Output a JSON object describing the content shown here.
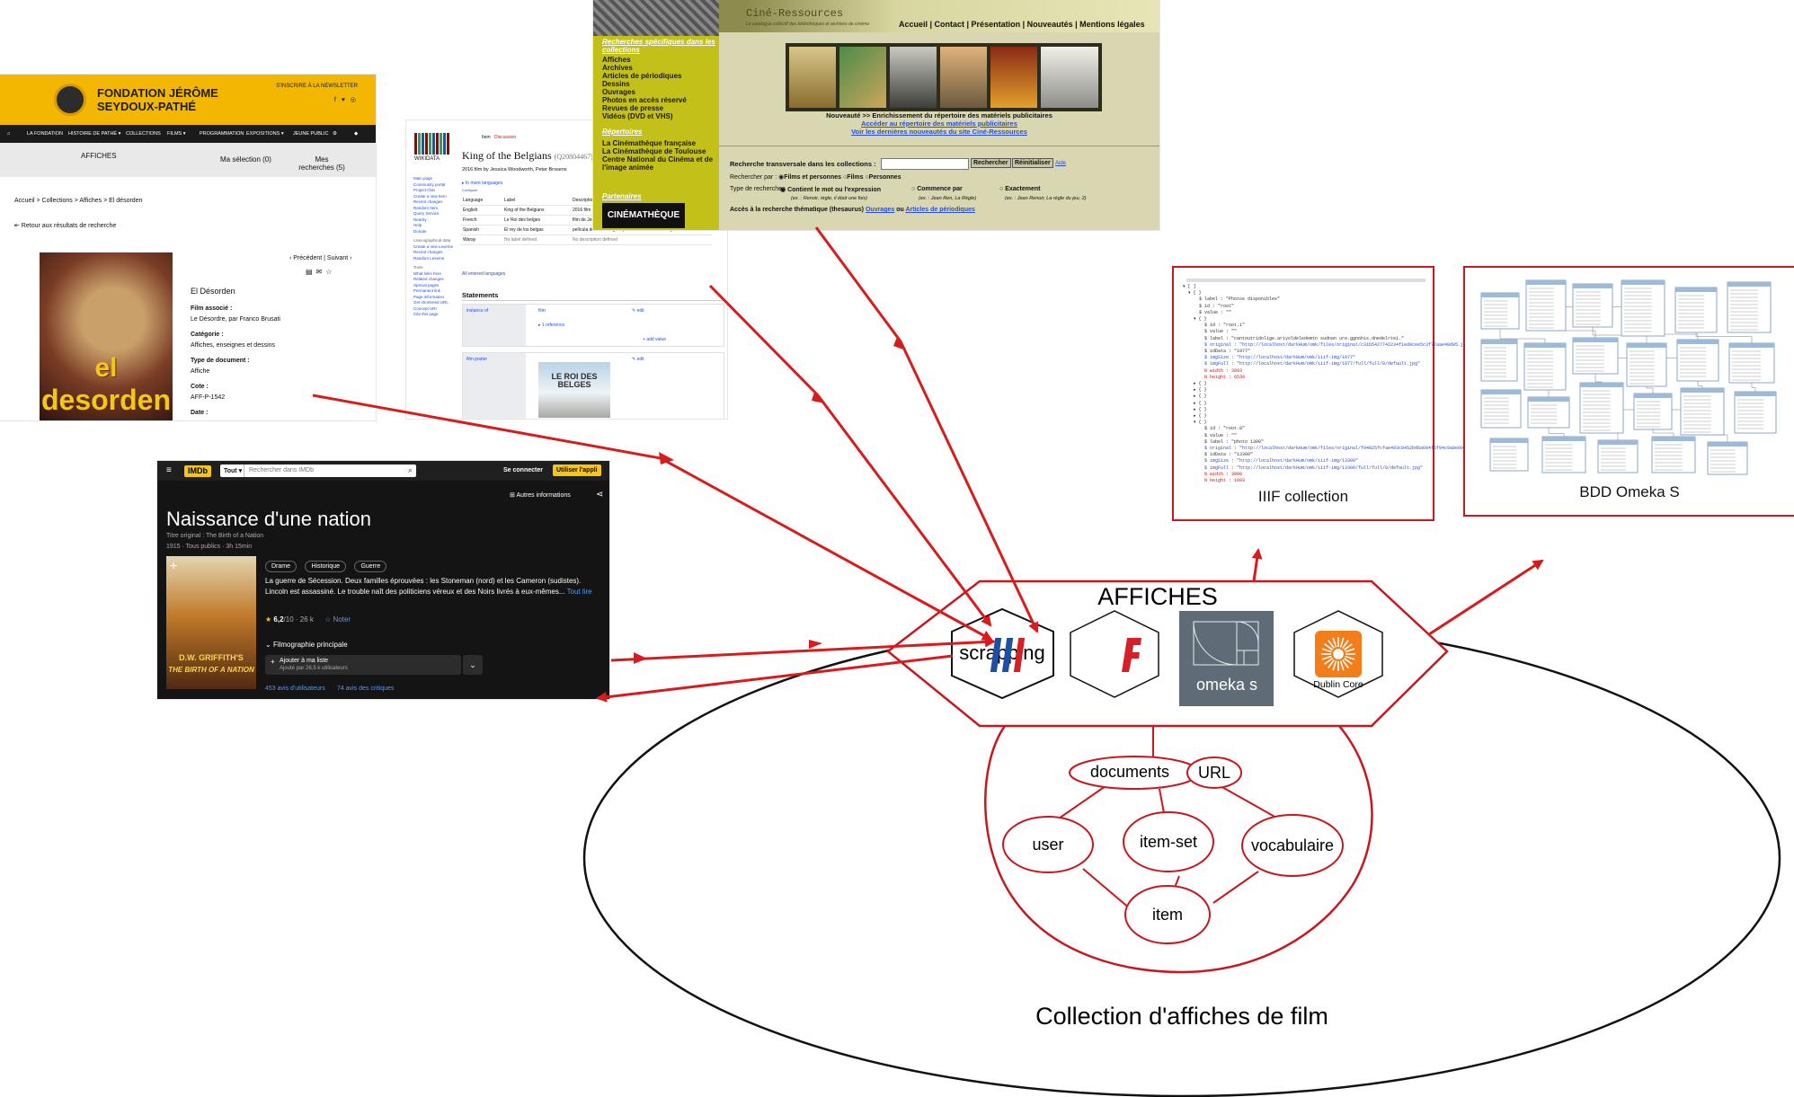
{
  "pathe": {
    "site_title": "FONDATION JÉRÔME SEYDOUX-PATHÉ",
    "newsletter": "S'INSCRIRE À LA NEWSLETTER",
    "social": "f ♥ ◎",
    "nav": [
      "LA FONDATION",
      "HISTOIRE DE PATHÉ ▾",
      "COLLECTIONS",
      "FILMS ▾",
      "PROGRAMMATION",
      "EXPOSITIONS ▾",
      "JEUNE PUBLIC"
    ],
    "band_title": "AFFICHES",
    "selection": "Ma sélection (0)",
    "searches": "Mes recherches (5)",
    "breadcrumb": "Accueil  > Collections  > Affiches  > El désorden",
    "back": "⇤ Retour aux résultats de recherche",
    "pager": "‹ Précédent | Suivant ›",
    "poster_word1": "el",
    "poster_word2": "desorden",
    "record_title": "El Désorden",
    "film_label": "Film associé :",
    "film_value": "Le Désordre, par Franco Brusati",
    "cat_label": "Catégorie :",
    "cat_value": "Affiches, enseignes et dessins",
    "type_label": "Type de document :",
    "type_value": "Affiche",
    "code_label": "Cote :",
    "code_value": "AFF-P-1542",
    "date_label": "Date :"
  },
  "wikidata": {
    "logo_text": "WIKIDATA",
    "tabs": [
      "Item",
      "Discussion"
    ],
    "title": "King of the Belgians",
    "qid": "(Q20804467)",
    "description": "2016 film by Jessica Woodworth, Peter Brosens",
    "more_languages": "▸ In more languages",
    "configure": "Configure",
    "side_links": [
      "Main page",
      "Community portal",
      "Project chat",
      "Create a new Item",
      "Recent changes",
      "Random Item",
      "Query Service",
      "Nearby",
      "Help",
      "Donate"
    ],
    "side_section2": "Lexicographical data",
    "side_links2": [
      "Create a new Lexeme",
      "Recent changes",
      "Random Lexeme"
    ],
    "side_section3": "Tools",
    "side_links3": [
      "What links here",
      "Related changes",
      "Special pages",
      "Permanent link",
      "Page information",
      "Get shortened URL",
      "Concept URI",
      "Cite this page"
    ],
    "table_headers": [
      "Language",
      "Label",
      "Description"
    ],
    "table_rows": [
      [
        "English",
        "King of the Belgians",
        "2016 film by Jessica Woodworth, Peter Brosens"
      ],
      [
        "French",
        "Le Roi des belges",
        "film de Jessica Woodworth et Peter Brosens, sorti en 2016"
      ],
      [
        "Spanish",
        "El rey de los belgas",
        "película de 2016 dirigida por Jessica Woodworth y Peter Brosens"
      ],
      [
        "Waray",
        "No label defined",
        "No description defined"
      ]
    ],
    "all_languages": "All entered languages",
    "statements": "Statements",
    "instance_of": "instance of",
    "film": "film",
    "edit": "✎ edit",
    "references": "▸ 1 reference",
    "add_value": "+ add value",
    "film_poster": "film poster",
    "poster_text": "LE ROI DES BELGES"
  },
  "cine": {
    "logo": "Ciné-Ressources",
    "subtitle": "Le catalogue collectif des bibliothèques et archives de cinéma",
    "menu": "Accueil | Contact | Présentation | Nouveautés | Mentions légales",
    "special_title": "Recherches spécifiques dans les collections",
    "special_items": [
      "Affiches",
      "Archives",
      "Articles de périodiques",
      "Dessins",
      "Ouvrages",
      "Photos en accès réservé",
      "Revues de presse",
      "Vidéos (DVD et VHS)"
    ],
    "rep_title": "Répertoires",
    "rep_items": [
      "La Cinémathèque française",
      "La Cinémathèque de Toulouse",
      "Centre National du Cinéma et de l'image animée"
    ],
    "partners": "Partenaires",
    "partner_logo": "CINÉMATHÈQUE",
    "news": "Nouveauté >> Enrichissement du répertoire des matériels publicitaires",
    "news_link1": "Accéder au répertoire des matériels publicitaires",
    "news_link2": "Voir les dernières nouveautés du site Ciné-Ressources",
    "search_label": "Recherche transversale dans les collections :",
    "search_btn": "Rechercher",
    "reset_btn": "Réinitialiser",
    "help": "Aide",
    "search_by": "Rechercher par :",
    "search_by_opts": [
      "Films et personnes",
      "Films",
      "Personnes"
    ],
    "search_type": "Type de recherche :",
    "search_type_opts": [
      "Contient le mot ou l'expression",
      "Commence par",
      "Exactement"
    ],
    "examples": [
      "(ex. : Renoir, règle, il était une fois)",
      "(ex. : Jean Ren, La Règle)",
      "(ex. : Jean Renoir, La règle du jeu, 2)"
    ],
    "thematic": "Accès à la recherche thématique (thesaurus)",
    "thematic_link1": "Ouvrages",
    "thematic_or": "ou",
    "thematic_link2": "Articles de périodiques"
  },
  "imdb": {
    "logo": "IMDb",
    "scope": "Tout ▾",
    "search_placeholder": "Rechercher dans IMDb",
    "signin": "Se connecter",
    "app": "Utiliser l'appli",
    "more_info": "Autres informations",
    "title": "Naissance d'une nation",
    "original": "Titre original : The Birth of a Nation",
    "meta": "1915 · Tous publics · 3h 15min",
    "genres": [
      "Drame",
      "Historique",
      "Guerre"
    ],
    "plot": "La guerre de Sécession. Deux familles éprouvées : les Stoneman (nord) et les Cameron (sudistes). Lincoln est assassiné. Le trouble naît des politiciens véreux et des Noirs livrés à eux-mêmes...",
    "read_all": "Tout lire",
    "rating": "6,2",
    "rating_max": "/10",
    "votes": "· 26 k",
    "rate": "☆ Noter",
    "filmography": "Filmographie principale",
    "watchlist": "Ajouter à ma liste",
    "watchlist_sub": "Ajouté par 26,5 k utilisateurs",
    "user_reviews": "453 avis d'utilisateurs",
    "critic_reviews": "74 avis des critiques",
    "poster_brand": "D.W. GRIFFITH'S",
    "poster_title": "THE BIRTH OF A NATION"
  },
  "iiif": {
    "caption": "IIIF collection",
    "json_lines": [
      "▾ [ ]",
      "  ▾ { }",
      "      $ label : \"Photos disponibles\"",
      "      $ id : \"root\"",
      "      $ value : \"\"",
      "    ▾ { }",
      "        $ id : \"root.1\"",
      "        $ value : \"\"",
      "        $ label : \"cantoutridolige.ariyoldeledemtn sudnan ure.ggnohis.dnedelrtei.\"",
      "        $ original : \"http://localhost/darkHum/omk/files/original/c31b5427742234f1ed0cee5c3f77aae48d95.jpg\"",
      "        $ idData : \"1977\"",
      "        $ imgSize : \"http://localhost/darkHum/omk/iiif-img/1977\"",
      "        $ imgFull : \"http://localhost/darkHum/omk/iiif-img/1977/full/full/0/default.jpg\"",
      "        N width : 3893",
      "        N height : 6539",
      "    ▸ { }",
      "    ▸ { }",
      "    ▸ { }",
      "    ▸ { }",
      "    ▸ { }",
      "    ▸ { }",
      "    ▾ { }",
      "        $ id : \"root.8\"",
      "        $ value : \"\"",
      "        $ label : \"photo 1300\"",
      "        $ original : \"http://localhost/darkHum/omk/files/original/f94825fcfae493c8452bd6a694f6f94c9a8e09ea.jpg\"",
      "        $ idData : \"13300\"",
      "        $ imgSize : \"http://localhost/darkHum/omk/iiif-img/13300\"",
      "        $ imgFull : \"http://localhost/darkHum/omk/iiif-img/13300/full/full/0/default.jpg\"",
      "        N width : 3000",
      "        N height : 1603"
    ]
  },
  "bdd": {
    "caption": "BDD Omeka S"
  },
  "affiches": {
    "title": "AFFICHES",
    "scrapping": "scrapping",
    "omeka_label": "omeka s",
    "dublin_core": "Dublin Core"
  },
  "collection": {
    "caption": "Collection d'affiches de film",
    "nodes": {
      "documents": "documents",
      "url": "URL",
      "user": "user",
      "item_set": "item-set",
      "vocabulaire": "vocabulaire",
      "item": "item"
    }
  },
  "colors": {
    "arrow": "#d81b1b",
    "box_border": "#c8171d",
    "pathe_yellow": "#f3b701",
    "cine_green": "#c4c01a",
    "imdb_yellow": "#f5c518",
    "omeka_grey": "#5f6b76"
  }
}
